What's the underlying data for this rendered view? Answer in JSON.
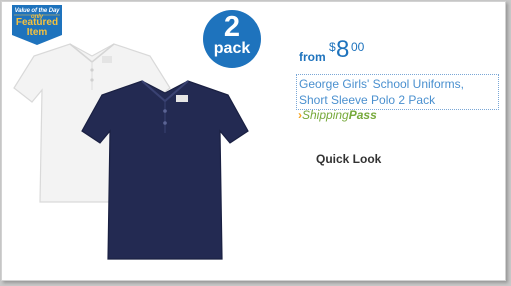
{
  "badge": {
    "line_top": "Value of the Day",
    "line_top_suffix": "only",
    "line1": "Featured",
    "line2": "Item"
  },
  "pack": {
    "number": "2",
    "word": "pack"
  },
  "price": {
    "prefix": "from",
    "currency": "$",
    "dollars": "8",
    "cents": "00"
  },
  "product": {
    "title": "George Girls' School Uniforms, Short Sleeve Polo 2 Pack"
  },
  "shipping": {
    "chevron": "›",
    "part1": "Shipping",
    "part2": "Pass"
  },
  "quick_look": {
    "label": "Quick Look"
  },
  "colors": {
    "accent": "#1e73bd",
    "badge_bg": "#1e73bd",
    "navy_polo": "#232a52",
    "white_polo": "#f3f3f3",
    "shipping_green": "#76a93a"
  },
  "icons": {
    "badge": "featured-item-ribbon-icon",
    "shipping": "shipping-pass-chevron-icon"
  }
}
